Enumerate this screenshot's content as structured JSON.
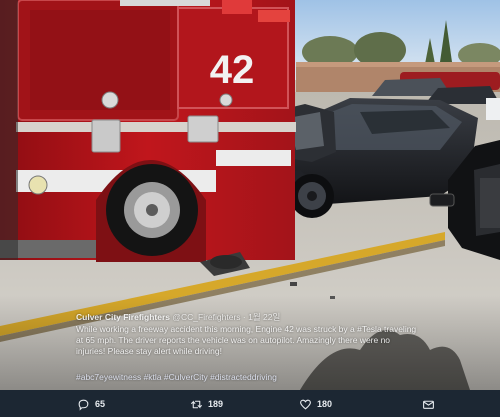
{
  "tweet": {
    "display_name": "Culver City Firefighters",
    "handle": "@CC_Firefighters",
    "separator": "·",
    "time": "1월 22일",
    "text": "While working a freeway accident this morning, Engine 42 was struck by a #Tesla traveling at 65 mph. The driver reports the vehicle was on autopilot. Amazingly there were no injuries! Please stay alert while driving!",
    "hashtags": "#abc7eyewitness #ktla #CulverCity #distracteddriving"
  },
  "photo": {
    "truck_number": "42"
  },
  "actions": {
    "replies": "65",
    "retweets": "189",
    "likes": "180"
  },
  "colors": {
    "action_bar": "#1c2733",
    "fire_truck_red": "#b5141a",
    "tesla_body": "#1c1e22",
    "curb_yellow": "#d6a82a"
  },
  "icons": [
    "reply-icon",
    "retweet-icon",
    "like-icon",
    "direct-message-icon"
  ]
}
